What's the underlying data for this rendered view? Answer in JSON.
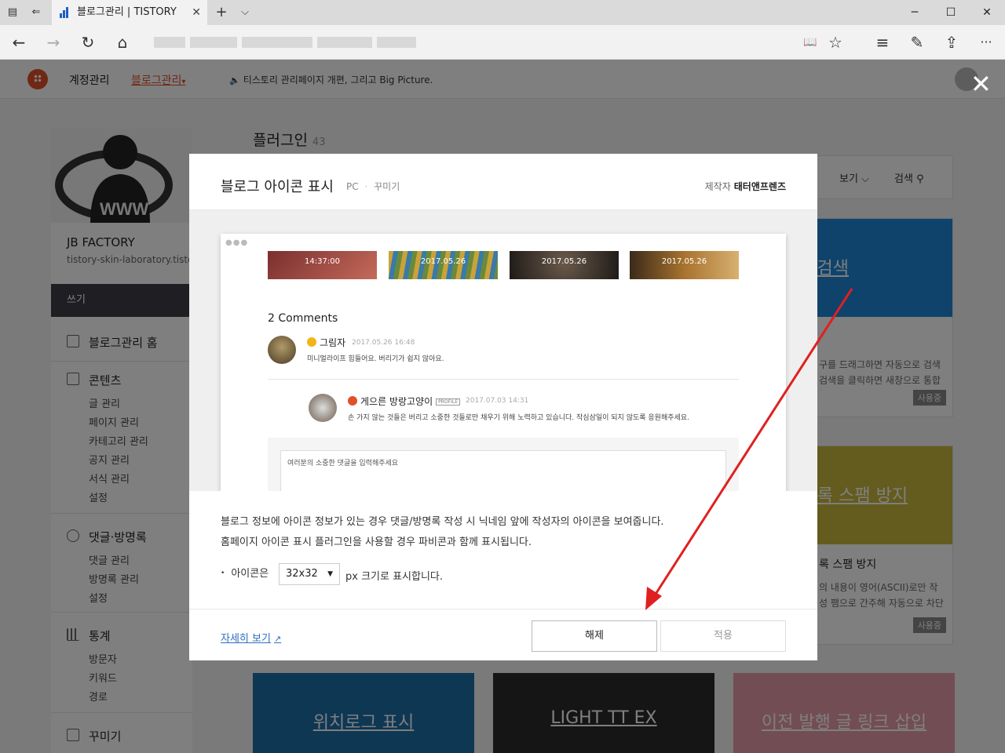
{
  "browser": {
    "tab_title": "블로그관리 | TISTORY",
    "tab_close": "✕",
    "new_tab": "+",
    "tab_list": "⌵",
    "win_minimize": "─",
    "win_maximize": "☐",
    "win_close": "✕",
    "back": "←",
    "forward": "→",
    "refresh": "↻",
    "home": "⌂",
    "reading_view": "📖",
    "favorite": "☆",
    "hub": "≡",
    "notes": "✎",
    "share": "⇪",
    "more": "···"
  },
  "topnav": {
    "account": "계정관리",
    "blog_admin": "블로그관리",
    "blog_admin_caret": "▾",
    "notice_icon": "🔈",
    "notice": "티스토리 관리페이지 개편, 그리고 Big Picture."
  },
  "sidebar": {
    "blog_name": "JB FACTORY",
    "blog_url": "tistory-skin-laboratory.tistor",
    "write": "쓰기",
    "home": "블로그관리 홈",
    "contents": {
      "title": "콘텐츠",
      "items": [
        "글 관리",
        "페이지 관리",
        "카테고리 관리",
        "공지 관리",
        "서식 관리",
        "설정"
      ]
    },
    "comments": {
      "title": "댓글·방명록",
      "items": [
        "댓글 관리",
        "방명록 관리",
        "설정"
      ]
    },
    "stats": {
      "title": "통계",
      "items": [
        "방문자",
        "키워드",
        "경로"
      ]
    },
    "decorate": {
      "title": "꾸미기"
    }
  },
  "plugins": {
    "title": "플러그인",
    "count": "43",
    "view": "보기",
    "view_caret": "⌵",
    "search": "검색",
    "search_icon": "⚲",
    "cards": [
      {
        "hero": "래그 검색",
        "title": "",
        "desc": "구를 드래그하면 자동으로 검색 검색을 클릭하면 새창으로 통합",
        "badge": "사용중",
        "color": "#1e87d6"
      },
      {
        "hero": "/방명록 스팸 방지",
        "title": "록 스팸 방지",
        "desc": "의 내용이 영어(ASCII)로만 작성 팸으로 간주해 자동으로 차단",
        "badge": "사용중",
        "color": "#c9b73c"
      }
    ],
    "bottom_cards": [
      {
        "label": "위치로그 표시",
        "color": "#1d6ea8"
      },
      {
        "label": "LIGHT TT EX",
        "color": "#2a2a2a"
      },
      {
        "label": "이전 발행 글 링크 삽입",
        "color": "#e79aa9"
      }
    ]
  },
  "overlay_close": "✕",
  "modal": {
    "title": "블로그 아이콘 표시",
    "platform": "PC",
    "category": "꾸미기",
    "meta_sep": "·",
    "author_label": "제작자",
    "author": "태터앤프렌즈",
    "preview": {
      "dots": "●●●",
      "thumb_labels": [
        "14:37:00",
        "2017.05.26",
        "2017.05.26",
        "2017.05.26"
      ],
      "comments_heading": "2 Comments",
      "comment1": {
        "name": "그림자",
        "date": "2017.05.26 16:48",
        "text": "미니멀라이프 힘들어요. 버리기가 쉽지 않아요."
      },
      "comment2": {
        "name": "게으른 방랑고양이",
        "badge": "PROFILE",
        "date": "2017.07.03 14:31",
        "text": "손 가지 않는 것들은 버리고 소중한 것들로만 채우기 위해 노력하고 있습니다. 작심삼일이 되지 않도록 응원해주세요."
      },
      "input_placeholder": "여러분의 소중한 댓글을 입력해주세요"
    },
    "desc1": "블로그 정보에 아이콘 정보가 있는 경우 댓글/방명록 작성 시 닉네임 앞에 작성자의 아이콘을 보여줍니다.",
    "desc2": "홈페이지 아이콘 표시 플러그인을 사용할 경우 파비콘과 함께 표시됩니다.",
    "option_bullet": "•",
    "option_label": "아이콘은",
    "option_value": "32x32",
    "option_caret": "▼",
    "option_after": "px 크기로 표시합니다.",
    "more_link": "자세히 보기",
    "more_icon": "↗",
    "release_button": "해제",
    "apply_button": "적용"
  },
  "colors": {
    "accent": "#e0502b",
    "annotation_arrow": "#e02020"
  }
}
